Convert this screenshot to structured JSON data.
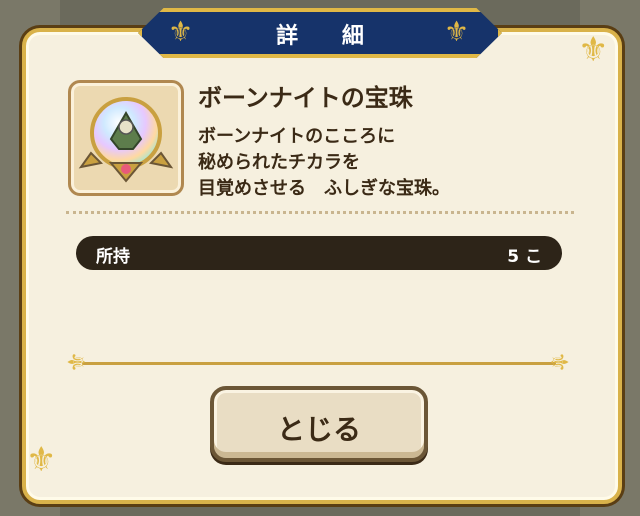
{
  "dialog": {
    "title": "詳 細"
  },
  "item": {
    "name": "ボーンナイトの宝珠",
    "icon": "bone-knight-orb-icon",
    "description_lines": [
      "ボーンナイトのこころに",
      "秘められたチカラを",
      "目覚めさせる　ふしぎな宝珠。"
    ],
    "owned_label": "所持",
    "owned_count": "5 こ"
  },
  "buttons": {
    "close_label": "とじる"
  },
  "colors": {
    "title_bg": "#16336a",
    "gold": "#e0b846",
    "panel": "#f6f0df",
    "dark_text": "#3b2a16"
  }
}
